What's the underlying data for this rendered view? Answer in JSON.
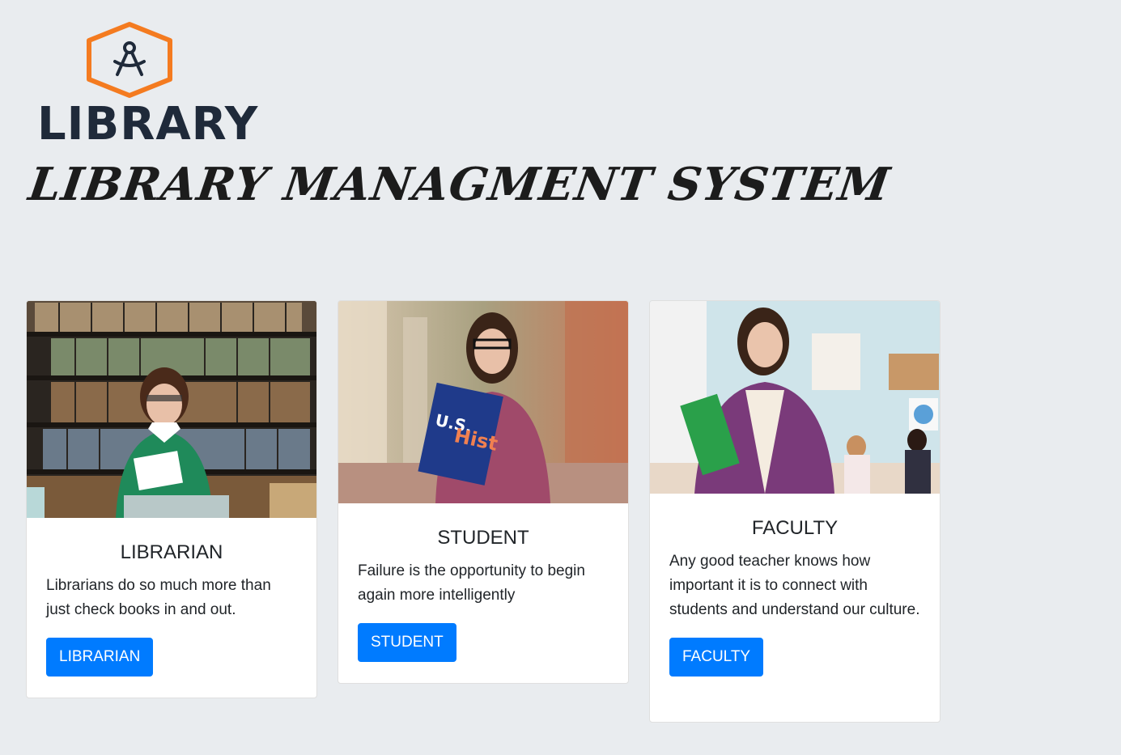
{
  "logo": {
    "icon": "compass-hexagon-icon",
    "wordmark": "LIBRARY",
    "hex_color": "#f47b20",
    "text_color": "#1f2a3a"
  },
  "page_title": "LIBRARY MANAGMENT SYSTEM",
  "cards": [
    {
      "image": "librarian-photo",
      "title": "LIBRARIAN",
      "text": "Librarians do so much more than just check books in and out.",
      "button": "LIBRARIAN"
    },
    {
      "image": "student-photo",
      "title": "STUDENT",
      "text": "Failure is the opportunity to begin again more intelligently",
      "button": "STUDENT"
    },
    {
      "image": "faculty-photo",
      "title": "FACULTY",
      "text": "Any good teacher knows how important it is to connect with students and understand our culture.",
      "button": "FACULTY"
    }
  ],
  "colors": {
    "background": "#e9ecef",
    "button": "#007bff",
    "card": "#ffffff"
  }
}
